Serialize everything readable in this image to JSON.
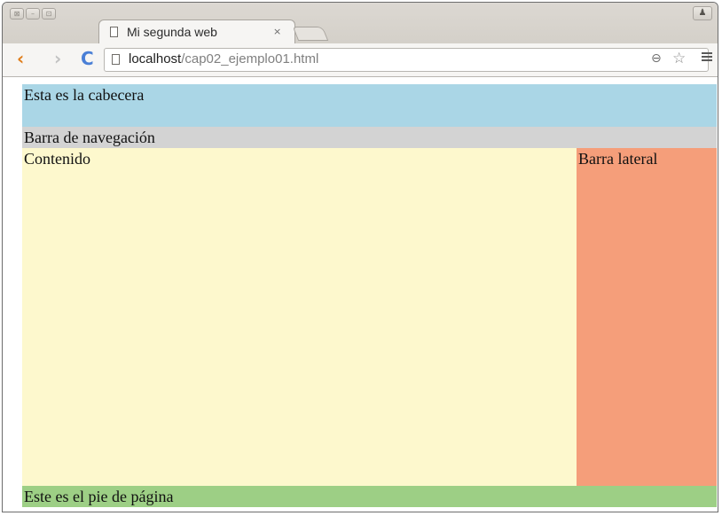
{
  "browser": {
    "tab": {
      "title": "Mi segunda web",
      "close": "×"
    },
    "window_controls": {
      "close": "⊠",
      "minimize": "–",
      "maximize": "⊡"
    },
    "profile_icon": "person-icon",
    "address_bar": {
      "host": "localhost",
      "path": "/cap02_ejemplo01.html"
    },
    "icons": {
      "back": "‹",
      "forward": "›",
      "reload": "C",
      "zoom": "⊖",
      "star": "☆"
    }
  },
  "page": {
    "header": "Esta es la cabecera",
    "nav": "Barra de navegación",
    "content": "Contenido",
    "sidebar": "Barra lateral",
    "footer": "Este es el pie de página"
  },
  "colors": {
    "header": "#aad6e6",
    "nav": "#d3d3d3",
    "content": "#fdf8cd",
    "sidebar": "#f59e7a",
    "footer": "#9dcf85"
  }
}
